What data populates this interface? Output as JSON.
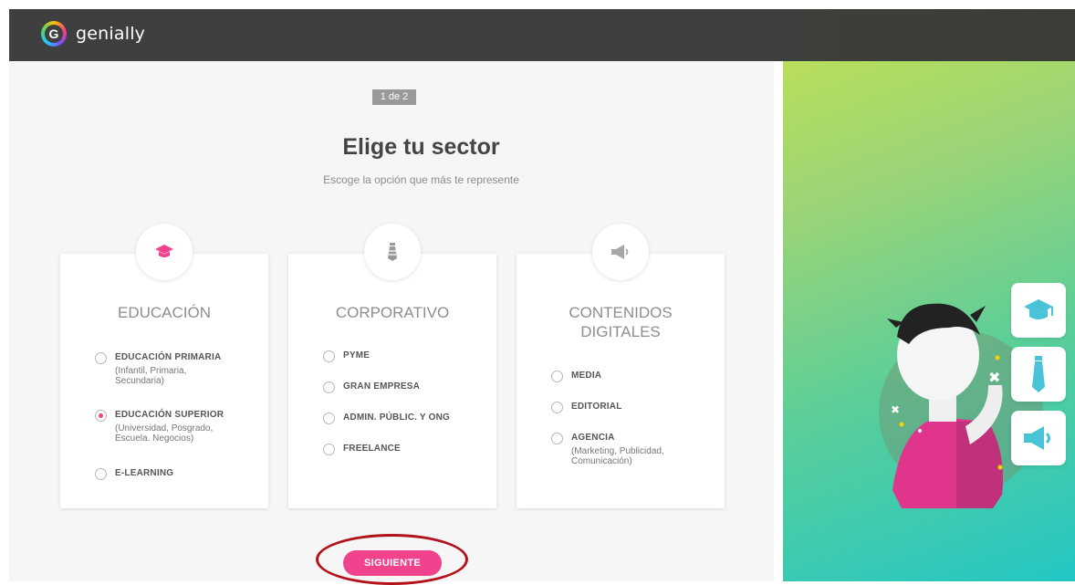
{
  "app": {
    "name": "genially"
  },
  "step": {
    "indicator": "1 de 2"
  },
  "header": {
    "title": "Elige tu sector",
    "subtitle": "Escoge la opción que más te represente"
  },
  "sectors": [
    {
      "title": "EDUCACIÓN",
      "icon": "graduation-cap-icon",
      "options": [
        {
          "label": "EDUCACIÓN PRIMARIA",
          "detail": "(Infantil, Primaria, Secundaria)",
          "selected": false
        },
        {
          "label": "EDUCACIÓN SUPERIOR",
          "detail": "(Universidad, Posgrado, Escuela. Negocios)",
          "selected": true
        },
        {
          "label": "E-LEARNING",
          "detail": "",
          "selected": false
        }
      ]
    },
    {
      "title": "CORPORATIVO",
      "icon": "tie-icon",
      "options": [
        {
          "label": "PYME",
          "detail": "",
          "selected": false
        },
        {
          "label": "GRAN EMPRESA",
          "detail": "",
          "selected": false
        },
        {
          "label": "ADMIN. PÚBLIC. Y ONG",
          "detail": "",
          "selected": false
        },
        {
          "label": "FREELANCE",
          "detail": "",
          "selected": false
        }
      ]
    },
    {
      "title": "CONTENIDOS DIGITALES",
      "icon": "megaphone-icon",
      "options": [
        {
          "label": "MEDIA",
          "detail": "",
          "selected": false
        },
        {
          "label": "EDITORIAL",
          "detail": "",
          "selected": false
        },
        {
          "label": "AGENCIA",
          "detail": "(Marketing, Publicidad, Comunicación)",
          "selected": false
        }
      ]
    }
  ],
  "actions": {
    "next": "SIGUIENTE"
  },
  "colors": {
    "accent": "#f0428d",
    "topbar": "#3f3f3f",
    "panel": "#f6f6f6",
    "highlight_ring": "#b3121a",
    "illustration_gradient_top": "#b9de5a",
    "illustration_gradient_bottom": "#23c6c4"
  },
  "illustration": {
    "badges": [
      "graduation-cap-icon",
      "tie-icon",
      "megaphone-icon"
    ]
  }
}
